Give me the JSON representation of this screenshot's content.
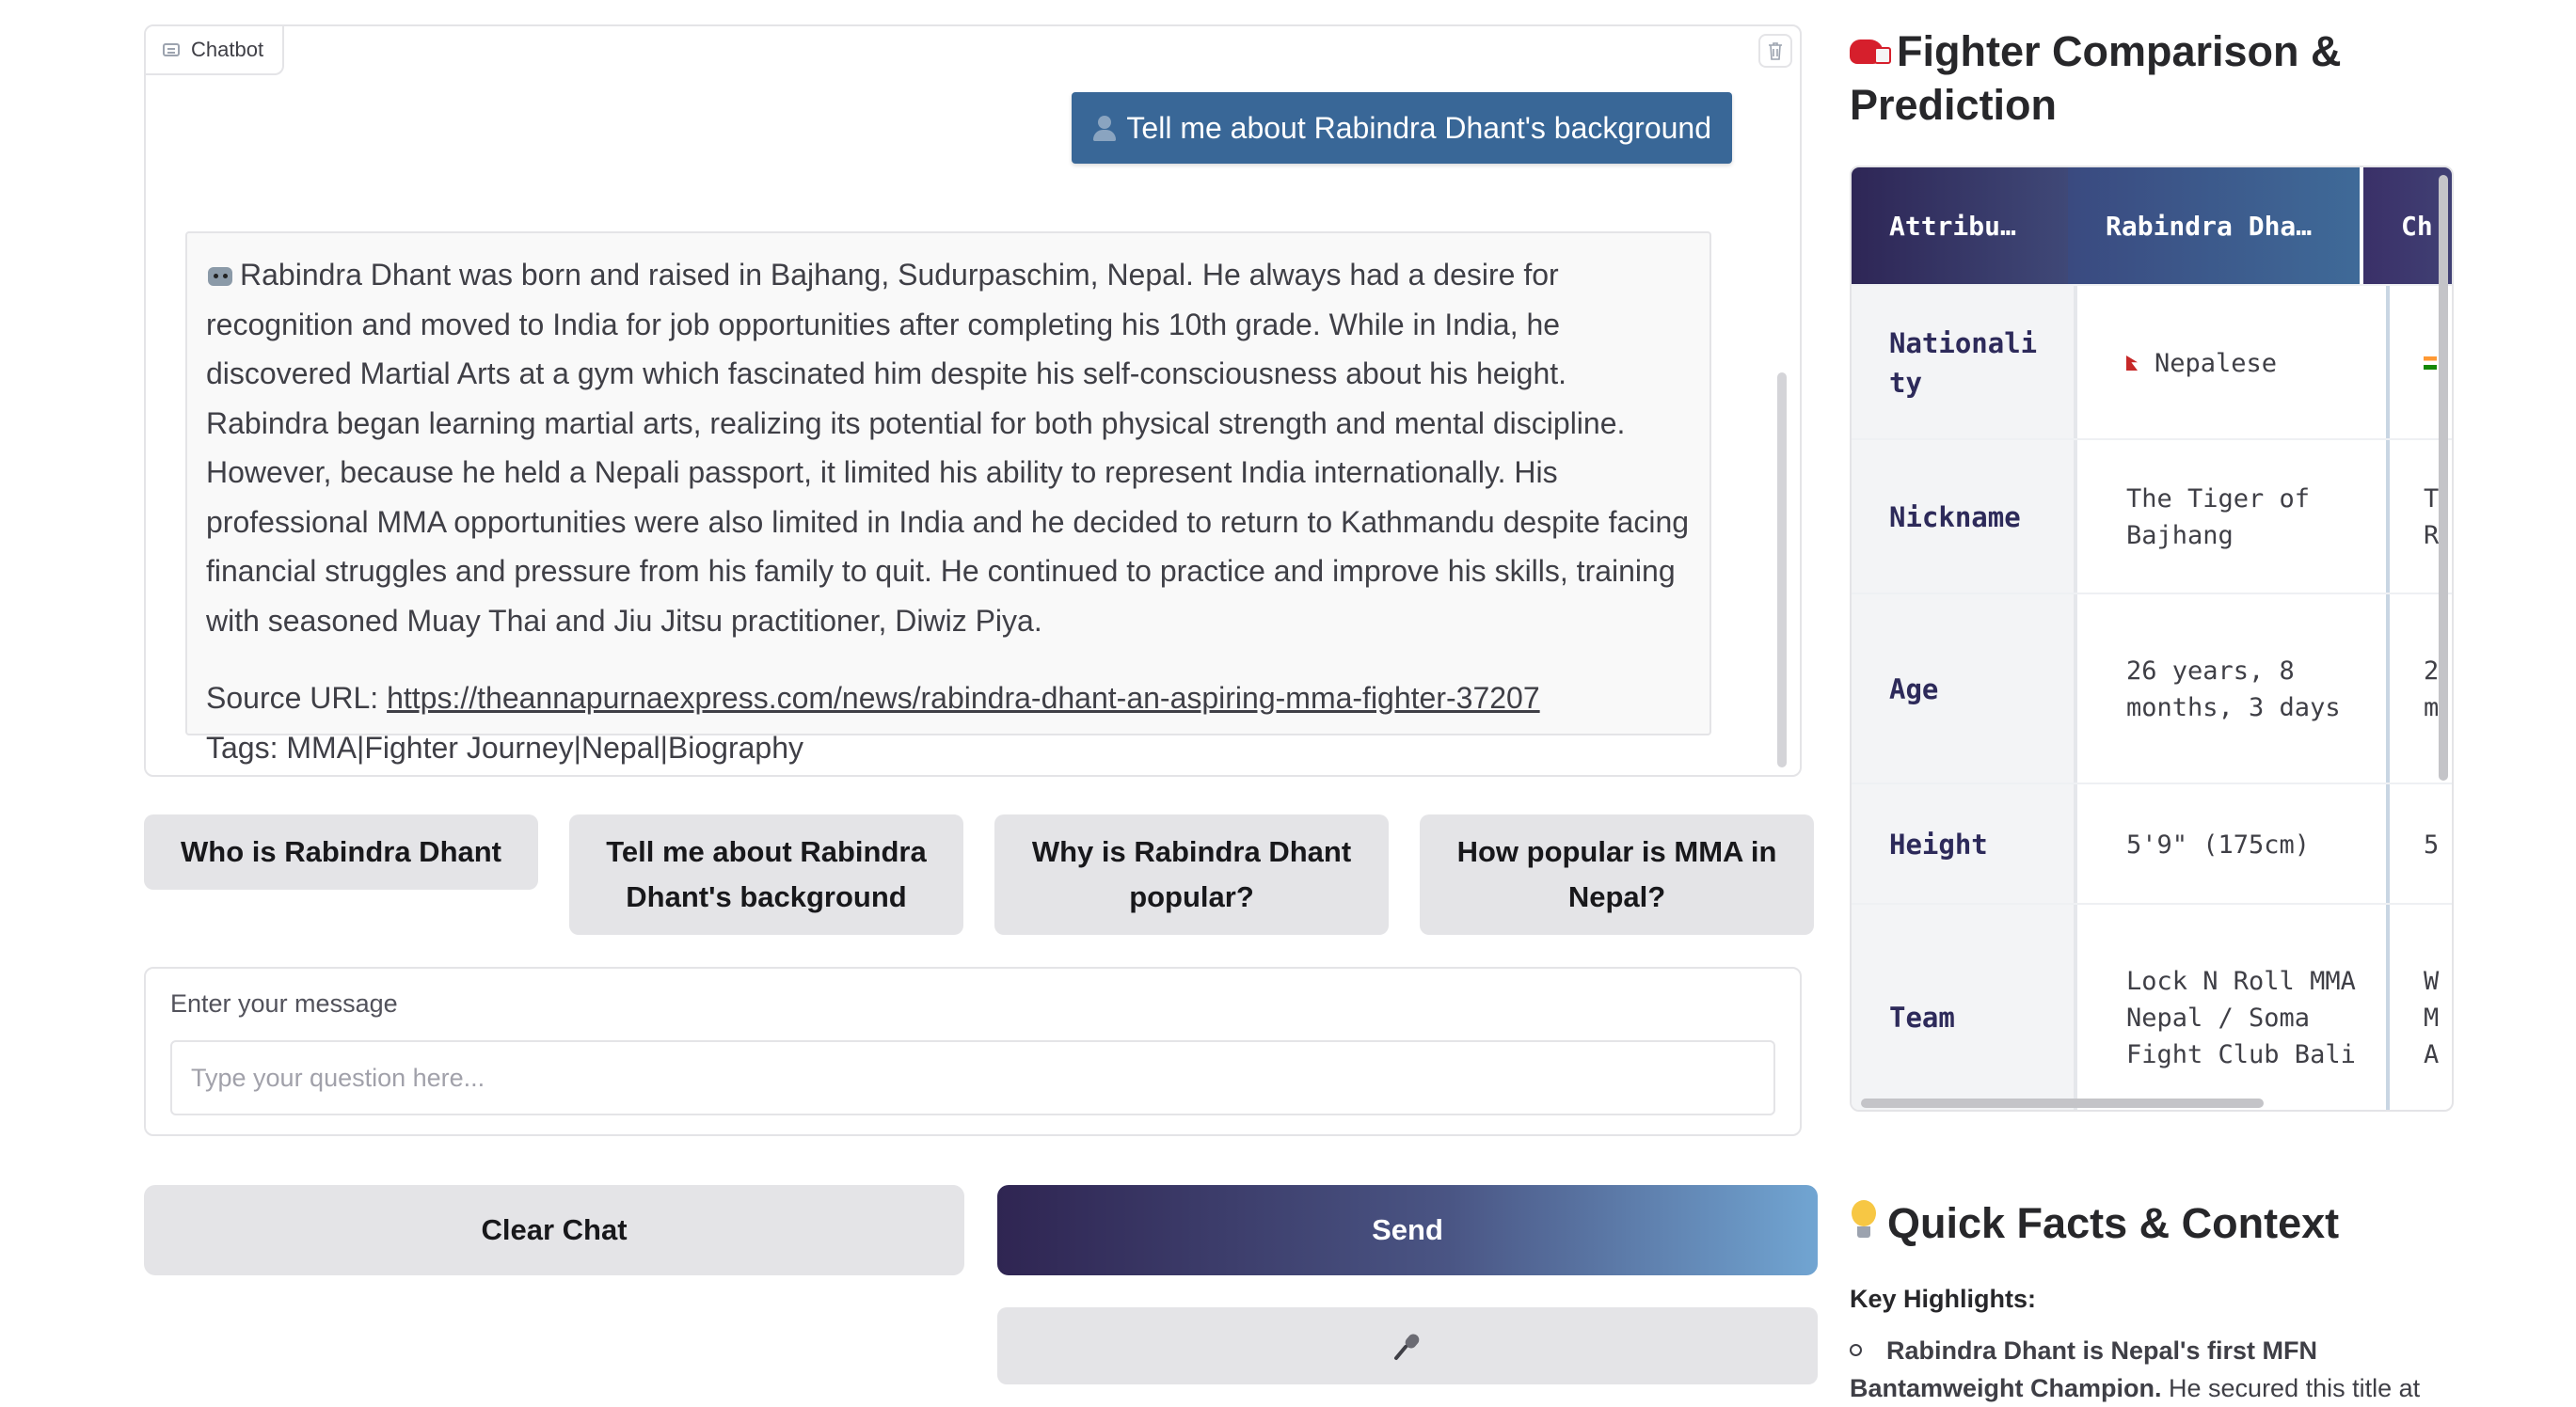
{
  "chatbot": {
    "label": "Chatbot",
    "user_message": "Tell me about Rabindra Dhant's background",
    "bot_message": {
      "body": "Rabindra Dhant was born and raised in Bajhang, Sudurpaschim, Nepal. He always had a desire for recognition and moved to India for job opportunities after completing his 10th grade. While in India, he discovered Martial Arts at a gym which fascinated him despite his self-consciousness about his height. Rabindra began learning martial arts, realizing its potential for both physical strength and mental discipline. However, because he held a Nepali passport, it limited his ability to represent India internationally. His professional MMA opportunities were also limited in India and he decided to return to Kathmandu despite facing financial struggles and pressure from his family to quit. He continued to practice and improve his skills, training with seasoned Muay Thai and Jiu Jitsu practitioner, Diwiz Piya.",
      "source_prefix": "Source URL: ",
      "source_url": "https://theannapurnaexpress.com/news/rabindra-dhant-an-aspiring-mma-fighter-37207",
      "tags": "Tags: MMA|Fighter Journey|Nepal|Biography"
    }
  },
  "suggestions": [
    "Who is Rabindra Dhant",
    "Tell me about Rabindra Dhant's background",
    "Why is Rabindra Dhant popular?",
    "How popular is MMA in Nepal?"
  ],
  "input": {
    "label": "Enter your message",
    "placeholder": "Type your question here..."
  },
  "buttons": {
    "clear": "Clear Chat",
    "send": "Send"
  },
  "comparison": {
    "title_line1": "Fighter Comparison &",
    "title_line2": "Prediction",
    "headers": [
      "Attribu…",
      "Rabindra Dha…",
      "Ch"
    ],
    "rows": [
      {
        "attr": "Nationali ty",
        "val": "Nepalese",
        "other": " "
      },
      {
        "attr": "Nickname",
        "val": "The Tiger of Bajhang",
        "other": "T\nR"
      },
      {
        "attr": "Age",
        "val": "26 years, 8 months, 3 days",
        "other": "2\nm"
      },
      {
        "attr": "Height",
        "val": "5'9\" (175cm)",
        "other": "5"
      },
      {
        "attr": "Team",
        "val": "Lock N Roll MMA Nepal / Soma Fight Club Bali",
        "other": "W\nM\nA"
      }
    ]
  },
  "facts": {
    "title": "Quick Facts & Context",
    "key_highlights": "Key Highlights:",
    "first_bold": "Rabindra Dhant is Nepal's first MFN Bantamweight Champion.",
    "first_rest": " He secured this title at"
  }
}
